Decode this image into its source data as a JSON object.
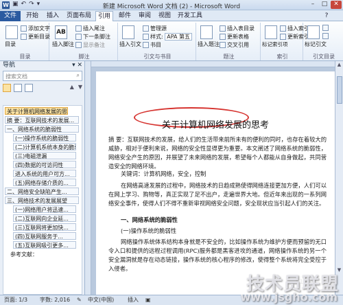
{
  "window": {
    "title": "新建 Microsoft Word 文档 (2) - Microsoft Word",
    "qat": [
      "↶",
      "↷",
      "▾"
    ]
  },
  "tabs": [
    "文件",
    "开始",
    "插入",
    "页面布局",
    "引用",
    "邮件",
    "审阅",
    "视图",
    "开发工具"
  ],
  "ribbon": {
    "groups": [
      {
        "label": "目录",
        "buttons": [
          "目录",
          "添加文字",
          "更新目录"
        ]
      },
      {
        "label": "脚注",
        "buttons": [
          "插入脚注",
          "插入尾注",
          "下一条脚注",
          "显示备注"
        ]
      },
      {
        "label": "引文与书目",
        "buttons": [
          "插入引文",
          "管理源",
          "样式:",
          "APA 第五",
          "书目"
        ]
      },
      {
        "label": "题注",
        "buttons": [
          "插入题注",
          "插入表目录",
          "更新表格",
          "交叉引用"
        ]
      },
      {
        "label": "索引",
        "buttons": [
          "标记索引项",
          "插入索引",
          "更新索引"
        ]
      },
      {
        "label": "引文目录",
        "buttons": [
          "标记引文",
          "插入引文目录",
          "更新表格"
        ]
      }
    ]
  },
  "nav": {
    "title": "导航",
    "search_placeholder": "搜索文档",
    "items": [
      "关于计算机网络发展的思考",
      "摘 要：互联网技术的发展...",
      "一、网络系统的脆弱性",
      "(一)操作系统的脆弱性",
      "(二)计算机系统本身的脆弱",
      "(三)电磁泄漏",
      "(四)数据的可访问性",
      "进入系统的用户可方...",
      "(五)网络存储介质的...",
      "二、网络安全缺陷产生...",
      "三、网络技术的发展展望",
      "(一)网络用户将迅速...",
      "(二)互联网向企业延...",
      "(三)互联网将更加快...",
      "(四)互联网服务于...",
      "(五)互联网吸引更多...",
      "参考文献："
    ]
  },
  "document": {
    "title": "关于计算机网络发展的思考",
    "abstract": "摘 要：互联网技术的发展，给人们的生活带来前所未有的便利的同时，也存在着较大的威胁，相对于便利来说，网络的安全性显得更为重要。本文阐述了网络系统的脆弱性，网络安全产生的原因，并展望了未来网络的发展，希望每个人都能从自身做起，共同营造安全的网络环境。",
    "keywords": "关键词：计算机网络，安全，控制",
    "intro": "在网络高速发展的过程中，网络技术的日趋成熟使得网络连接更加方便，人们可以在网上学习、购物等，真正实现了足不出户，走遍世界大地。但近年来出现的一系列网络安全事件，使得人们不得不重新审视网络安全问题，安全现状应当引起人们的关注。",
    "heading1": "一、网络系统的脆弱性",
    "heading2": "(一)操作系统的脆弱性",
    "body": "网络操作系统体系结构本身就是不安全的，比如操作系统为维护方便而预留的无口令入口和提供的远程过程调用(RPC)服务都是黑客进攻的通道，网络操作系统的另一个安全漏洞就是存在动态链接，操作系统的核心程序的修改，使得整个系统将完全受控于入侵者。"
  },
  "status": {
    "page": "页面: 1/3",
    "words": "字数: 2,016",
    "lang": "中文(中国)",
    "mode": "插入",
    "zoom": "100%"
  },
  "watermark": {
    "brand": "技术员联盟",
    "url": "www.jsgho.com",
    "small": "51.net"
  }
}
